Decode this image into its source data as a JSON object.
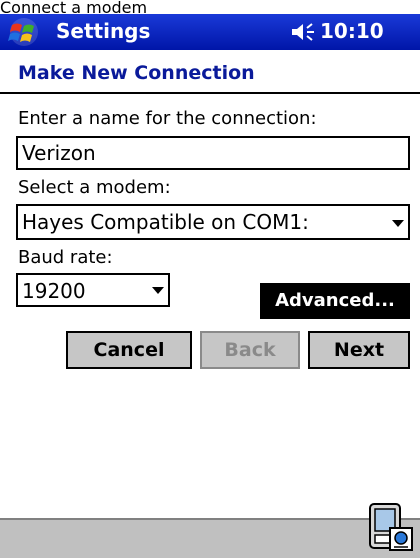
{
  "caption": "Connect a modem",
  "titlebar": {
    "title": "Settings",
    "time": "10:10",
    "start_icon": "windows-flag-icon",
    "volume_icon": "speaker-icon"
  },
  "page": {
    "heading": "Make New Connection",
    "name_label": "Enter a name for the connection:",
    "name_value": "Verizon",
    "modem_label": "Select a modem:",
    "modem_value": "Hayes Compatible on COM1:",
    "baud_label": "Baud rate:",
    "baud_value": "19200"
  },
  "buttons": {
    "advanced": "Advanced...",
    "cancel": "Cancel",
    "back": "Back",
    "next": "Next"
  },
  "bottombar": {
    "sip_icon": "input-panel-icon"
  },
  "colors": {
    "titlebar": "#0a24c8",
    "heading": "#0a1a9a",
    "button_face": "#c6c6c6",
    "bottombar": "#c0c0c0"
  }
}
